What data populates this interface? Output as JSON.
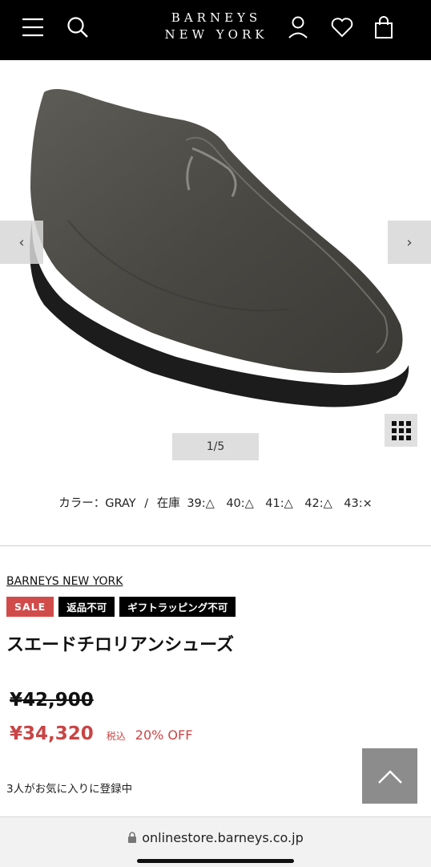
{
  "header": {
    "logo_line1": "BARNEYS",
    "logo_line2": "NEW YORK",
    "icons": [
      "menu-icon",
      "search-icon",
      "user-icon",
      "heart-icon",
      "bag-icon"
    ],
    "background": "#000000"
  },
  "gallery": {
    "counter": "1/5",
    "prev_icon": "chevron-left-icon",
    "next_icon": "chevron-right-icon",
    "grid_icon": "grid-icon"
  },
  "stock": {
    "color_label": "カラー：GRAY",
    "separator": "/",
    "stock_label": "在庫",
    "sizes": "39:△　40:△　41:△　42:△　43:×"
  },
  "product": {
    "brand": "BARNEYS NEW YORK",
    "badges": {
      "sale": "SALE",
      "no_return": "返品不可",
      "no_gift": "ギフトラッピング不可"
    },
    "title": "スエードチロリアンシューズ",
    "original_price": "¥42,900",
    "sale_price": "¥34,320",
    "tax_label": "税込",
    "discount": "20% OFF",
    "favorites": "3人がお気に入りに登録中",
    "accent_color": "#c94444"
  },
  "browser": {
    "url": "onlinestore.barneys.co.jp",
    "lock_icon": "lock-icon"
  }
}
